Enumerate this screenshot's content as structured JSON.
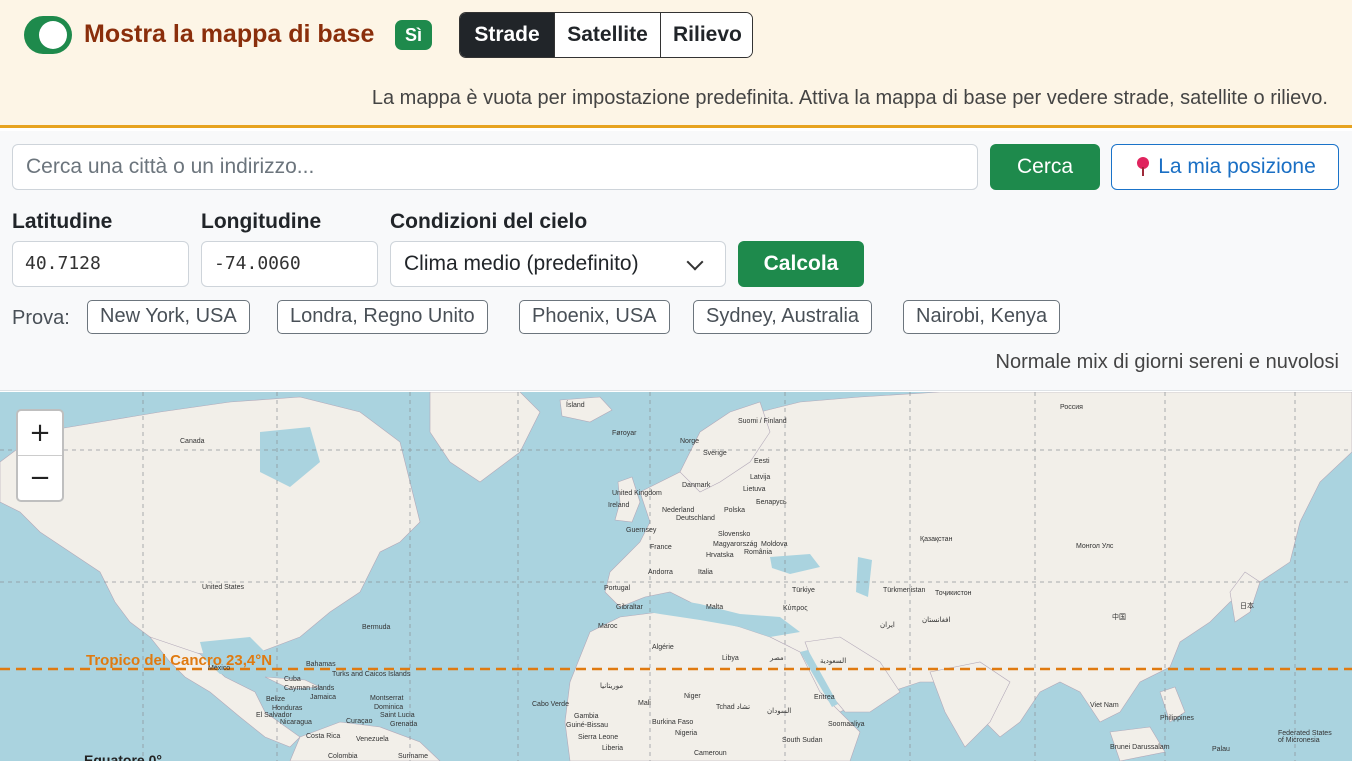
{
  "banner": {
    "title": "Mostra la mappa di base",
    "badge": "Sì",
    "layers": [
      "Strade",
      "Satellite",
      "Rilievo"
    ],
    "active_layer": "Strade",
    "note": "La mappa è vuota per impostazione predefinita. Attiva la mappa di base per vedere strade, satellite o rilievo."
  },
  "search": {
    "placeholder": "Cerca una città o un indirizzo...",
    "button": "Cerca",
    "location_button": "La mia posizione"
  },
  "form": {
    "lat_label": "Latitudine",
    "lat_value": "40.7128",
    "lon_label": "Longitudine",
    "lon_value": "-74.0060",
    "sky_label": "Condizioni del cielo",
    "sky_value": "Clima medio (predefinito)",
    "calc_button": "Calcola"
  },
  "presets": {
    "label": "Prova:",
    "items": [
      "New York, USA",
      "Londra, Regno Unito",
      "Phoenix, USA",
      "Sydney, Australia",
      "Nairobi, Kenya"
    ]
  },
  "sky_note": "Normale mix di giorni sereni e nuvolosi",
  "map": {
    "zoom_in": "+",
    "zoom_out": "−",
    "tropic_label": "Tropico del Cancro 23,4°N",
    "equator_label": "Equatore 0°",
    "labels": [
      "Ísland",
      "Canada",
      "Føroyar",
      "Suomi / Finland",
      "Россия",
      "Norge",
      "Sverige",
      "Eesti",
      "Latvija",
      "Lietuva",
      "Danmark",
      "United Kingdom",
      "Ireland",
      "Nederland",
      "Deutschland",
      "Polska",
      "Беларусь",
      "Guernsey",
      "Slovensko",
      "France",
      "Magyarország",
      "Moldova",
      "Hrvatska",
      "România",
      "Қазақстан",
      "Монгол Улс",
      "United States",
      "Andorra",
      "Italia",
      "Portugal",
      "Türkiye",
      "Gibraltar",
      "Malta",
      "Türkmenistan",
      "Тоҷикистон",
      "Bermuda",
      "Maroc",
      "Κύπρος",
      "ایران",
      "افغانستان",
      "中国",
      "日本",
      "Algérie",
      "Libya",
      "مصر",
      "السعودية",
      "Bahamas",
      "México",
      "Cuba",
      "Cayman Islands",
      "Jamaica",
      "Turks and Caicos Islands",
      "Montserrat",
      "Dominica",
      "Saint Lucia",
      "Belize",
      "Honduras",
      "El Salvador",
      "Nicaragua",
      "موريتانيا",
      "Mali",
      "Niger",
      "Tchad تشاد",
      "السودان",
      "Eritrea",
      "Cabo Verde",
      "Gambia",
      "Burkina Faso",
      "Nigeria",
      "Guiné-Bissau",
      "Sierra Leone",
      "Liberia",
      "Cameroun",
      "South Sudan",
      "Soomaaliya",
      "Costa Rica",
      "Curaçao",
      "Grenada",
      "Venezuela",
      "Colombia",
      "Suriname",
      "Philippines",
      "Viet Nam",
      "Brunei Darussalam",
      "Palau",
      "Federated States of Micronesia"
    ]
  }
}
